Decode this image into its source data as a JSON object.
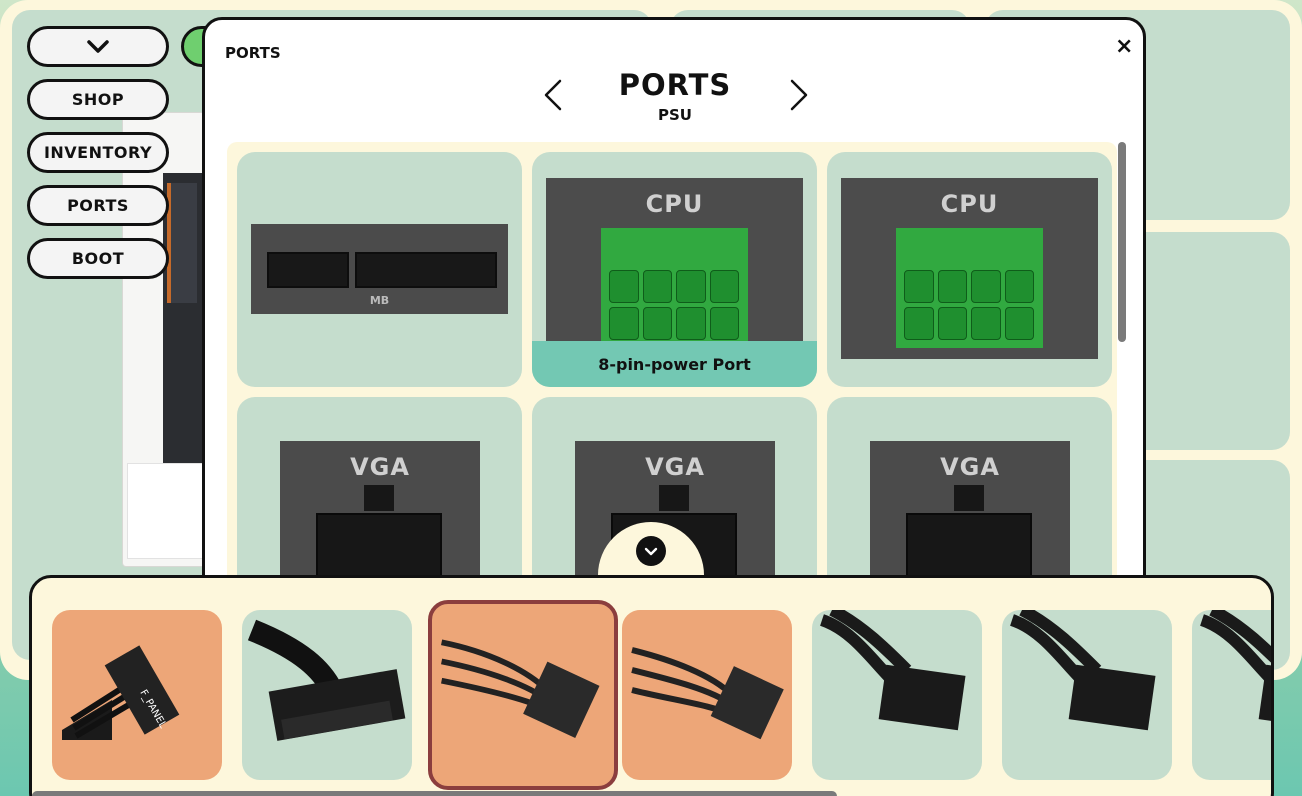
{
  "nav": {
    "toggle_icon": "chevron-down-icon",
    "shop": "SHOP",
    "inventory": "INVENTORY",
    "ports": "PORTS",
    "boot": "BOOT"
  },
  "modal": {
    "label": "PORTS",
    "close": "×",
    "title": "PORTS",
    "subtitle": "PSU",
    "prev_icon": "chevron-left-icon",
    "next_icon": "chevron-right-icon"
  },
  "ports": [
    {
      "label": "MB",
      "image": "24-pin motherboard power port"
    },
    {
      "label": "CPU",
      "image": "8-pin CPU power port (highlighted)",
      "hover_label": "8-pin-power Port"
    },
    {
      "label": "CPU",
      "image": "8-pin CPU power port (highlighted)"
    },
    {
      "label": "VGA",
      "image": "8-pin VGA power port"
    },
    {
      "label": "VGA",
      "image": "8-pin VGA power port"
    },
    {
      "label": "VGA",
      "image": "8-pin VGA power port"
    }
  ],
  "scroll_down_icon": "chevron-down-icon",
  "tray": {
    "items": [
      {
        "name": "front-panel-cable",
        "text": "F_PANEL",
        "color": "#eda678"
      },
      {
        "name": "24-pin-cable",
        "color": "#c5ddcd"
      },
      {
        "name": "8-pin-cable",
        "color": "#eda678",
        "selected": true
      },
      {
        "name": "8-pin-cable",
        "color": "#eda678"
      },
      {
        "name": "8-pin-cable",
        "color": "#c5ddcd"
      },
      {
        "name": "8-pin-cable",
        "color": "#c5ddcd"
      },
      {
        "name": "8-pin-cable",
        "color": "#c5ddcd"
      }
    ]
  },
  "colors": {
    "frame": "#fdf7dc",
    "panel": "#c5ddcd",
    "accent_orange": "#eda678",
    "accent_teal": "#73c8b3",
    "highlight_green": "#28c83c",
    "selected_border": "#8b3e3e"
  }
}
